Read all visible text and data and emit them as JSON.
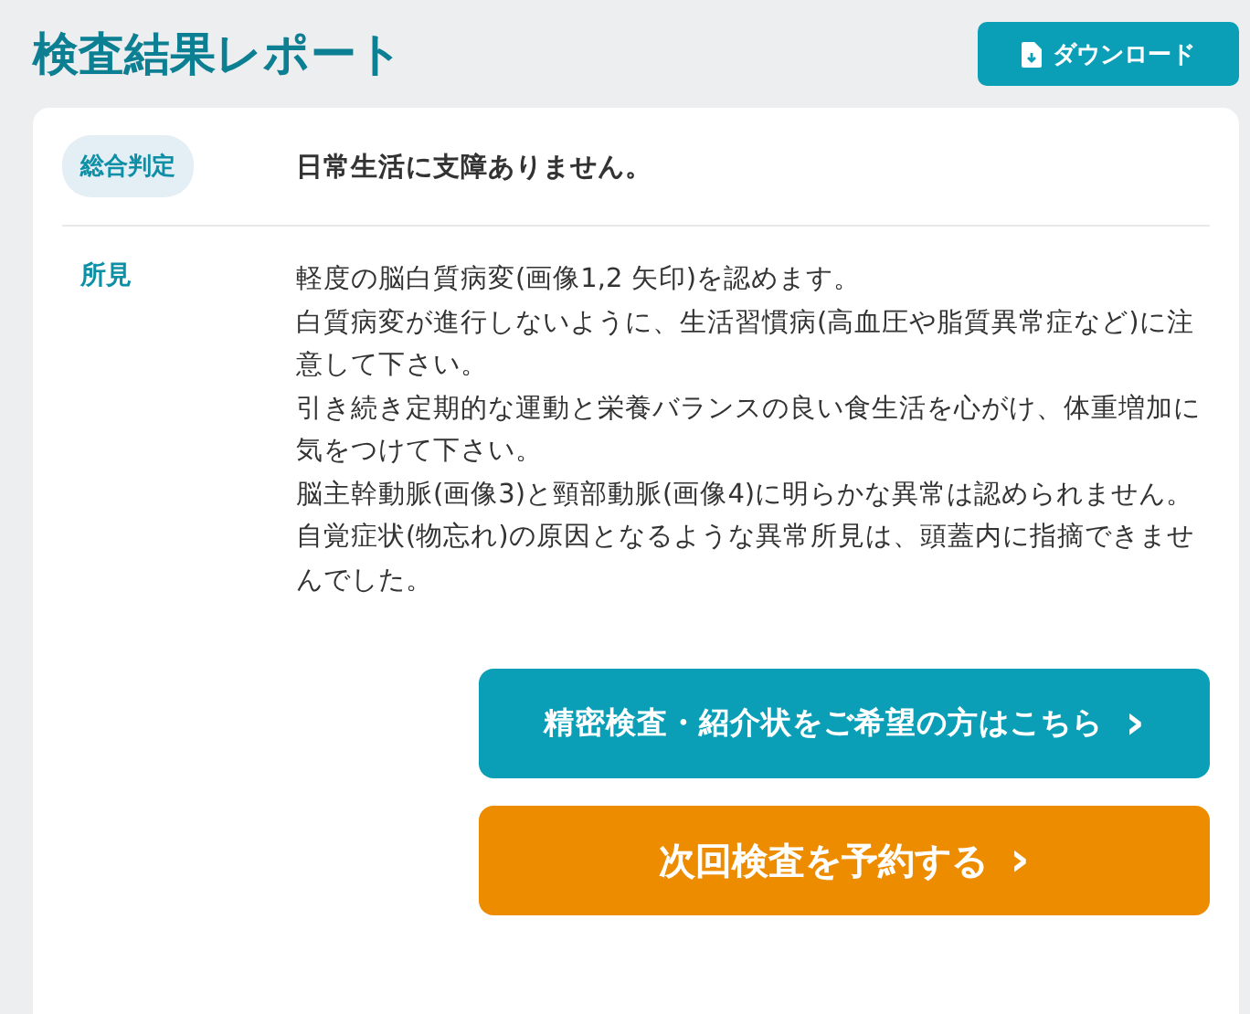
{
  "title": "検査結果レポート",
  "download_button": "ダウンロード",
  "summary": {
    "label": "総合判定",
    "text": "日常生活に支障ありません。"
  },
  "findings": {
    "label": "所見",
    "paragraphs": [
      "軽度の脳白質病変(画像1,2 矢印)を認めます。",
      "白質病変が進行しないように、生活習慣病(高血圧や脂質異常症など)に注意して下さい。",
      "引き続き定期的な運動と栄養バランスの良い食生活を心がけ、体重増加に気をつけて下さい。",
      "脳主幹動脈(画像3)と頸部動脈(画像4)に明らかな異常は認められません。",
      "自覚症状(物忘れ)の原因となるような異常所見は、頭蓋内に指摘できませんでした。"
    ]
  },
  "actions": [
    {
      "kind": "secondary",
      "label": "精密検査・紹介状をご希望の方はこちら",
      "arrow": "›"
    },
    {
      "kind": "primary",
      "label": "次回検査を予約する",
      "arrow": "›"
    }
  ]
}
